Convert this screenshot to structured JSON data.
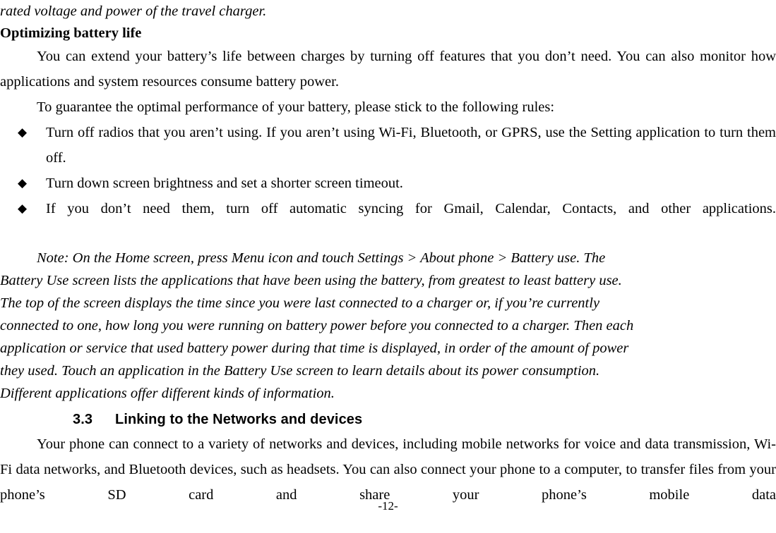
{
  "document": {
    "page_number_label": "-12-",
    "text_color": "#000000",
    "background_color": "#ffffff"
  },
  "body": {
    "continued_line": "rated voltage and power of the travel charger.",
    "subheading": "Optimizing battery life",
    "paragraphs": [
      "You can extend your battery’s life between charges by turning off features that you don’t need. You can also monitor how applications and system resources consume battery power.",
      "To guarantee the optimal performance of your battery, please stick to the following rules:"
    ],
    "bullet_marker": "◆",
    "bullets": [
      "Turn off radios that you aren’t using. If you aren’t using Wi-Fi, Bluetooth, or GPRS, use the Setting application to turn them off.",
      "Turn down screen brightness and set a shorter screen timeout.",
      "If you don’t need them, turn off automatic syncing for Gmail, Calendar, Contacts, and other applications."
    ],
    "note": {
      "lines": [
        "Note: On the Home screen, press Menu icon and touch Settings > About phone > Battery use. The",
        "Battery Use screen lists the applications that have been using the battery, from greatest to least battery use.",
        "The top of the screen displays the time since you were last connected to a charger or, if you’re currently",
        "connected to one, how long you were running on battery power before you connected to a charger. Then each",
        "application or service that used battery power during that time is displayed, in order of the amount of power",
        "they used. Touch an application in the Battery Use screen to learn details about its power consumption.",
        "Different applications offer different kinds of information."
      ]
    },
    "section": {
      "number": "3.3",
      "title": "Linking to the Networks and devices",
      "paragraph": "Your phone can connect to a variety of networks and devices, including mobile networks for voice and data transmission, Wi-Fi data networks, and Bluetooth devices, such as headsets. You can also connect your phone to a computer, to transfer files from your phone’s SD card and share your phone’s mobile data"
    }
  }
}
